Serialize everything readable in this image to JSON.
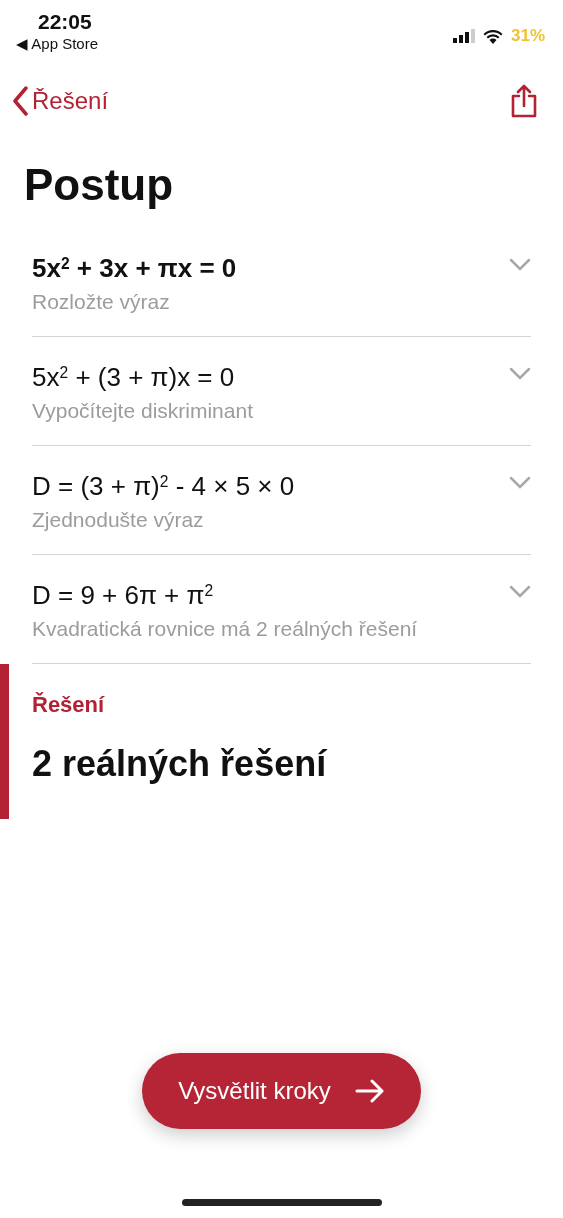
{
  "status_bar": {
    "time": "22:05",
    "back_app": "◀ App Store",
    "battery": "31%"
  },
  "nav": {
    "back_label": "Řešení"
  },
  "title": "Postup",
  "steps": [
    {
      "formula": "5x$^{2}$ + 3x + πx = 0",
      "description": "Rozložte výraz",
      "highlighted": true,
      "expanded": false
    },
    {
      "formula": "5x$^{2}$ + (3 + π)x = 0",
      "description": "Vypočítejte diskriminant",
      "highlighted": false,
      "expanded": false
    },
    {
      "formula": "D = (3 + π)$^{2}$ - 4 × 5 × 0",
      "description": "Zjednodušte výraz",
      "highlighted": false,
      "expanded": false
    },
    {
      "formula": "D = 9 + 6π + π$^{2}$",
      "description": "Kvadratická rovnice má 2 reálných řešení",
      "highlighted": false,
      "expanded": false
    }
  ],
  "solution": {
    "label": "Řešení",
    "value": "2 reálných řešení"
  },
  "action_button": {
    "label": "Vysvětlit kroky"
  }
}
